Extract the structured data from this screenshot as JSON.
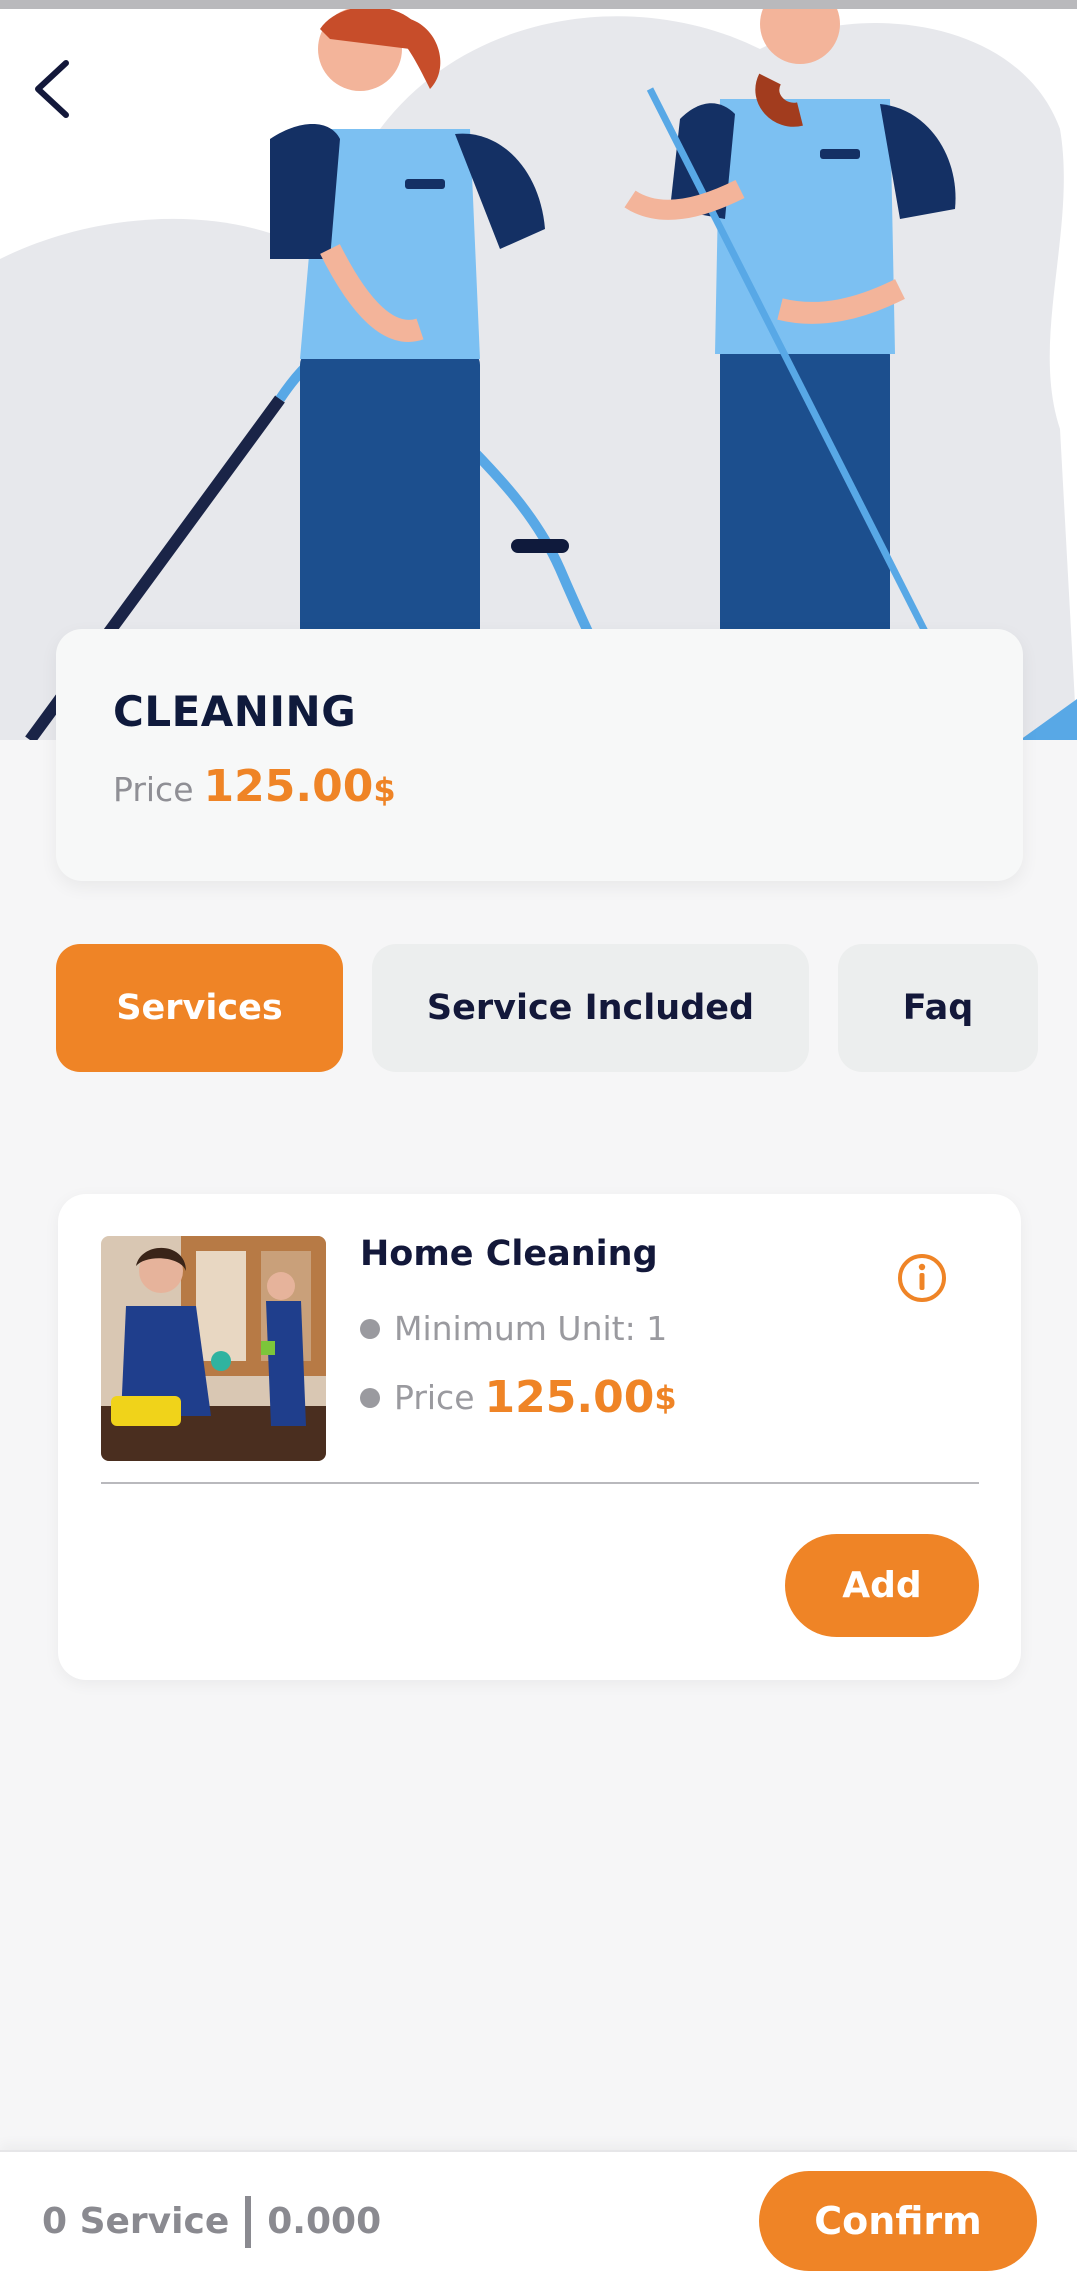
{
  "header": {
    "back_icon": "chevron-left-icon",
    "hero_image": "cleaning-staff-illustration"
  },
  "title_card": {
    "title": "CLEANING",
    "price_label": "Price",
    "price_value": "125.00",
    "currency": "$"
  },
  "tabs": [
    {
      "label": "Services",
      "active": true
    },
    {
      "label": "Service Included",
      "active": false
    },
    {
      "label": "Faq",
      "active": false
    }
  ],
  "services": [
    {
      "name": "Home Cleaning",
      "min_unit": "Minimum Unit: 1",
      "price_label": "Price",
      "price_value": "125.00",
      "currency": "$",
      "info_icon": "info-icon",
      "add_label": "Add"
    }
  ],
  "footer": {
    "count_text": "0 Service",
    "total_text": "0.000",
    "confirm_label": "Confirm"
  },
  "colors": {
    "accent": "#ef8426",
    "navy": "#13183a",
    "muted": "#8f8f95",
    "tab_inactive": "#eceeee",
    "background": "#f6f6f7"
  }
}
